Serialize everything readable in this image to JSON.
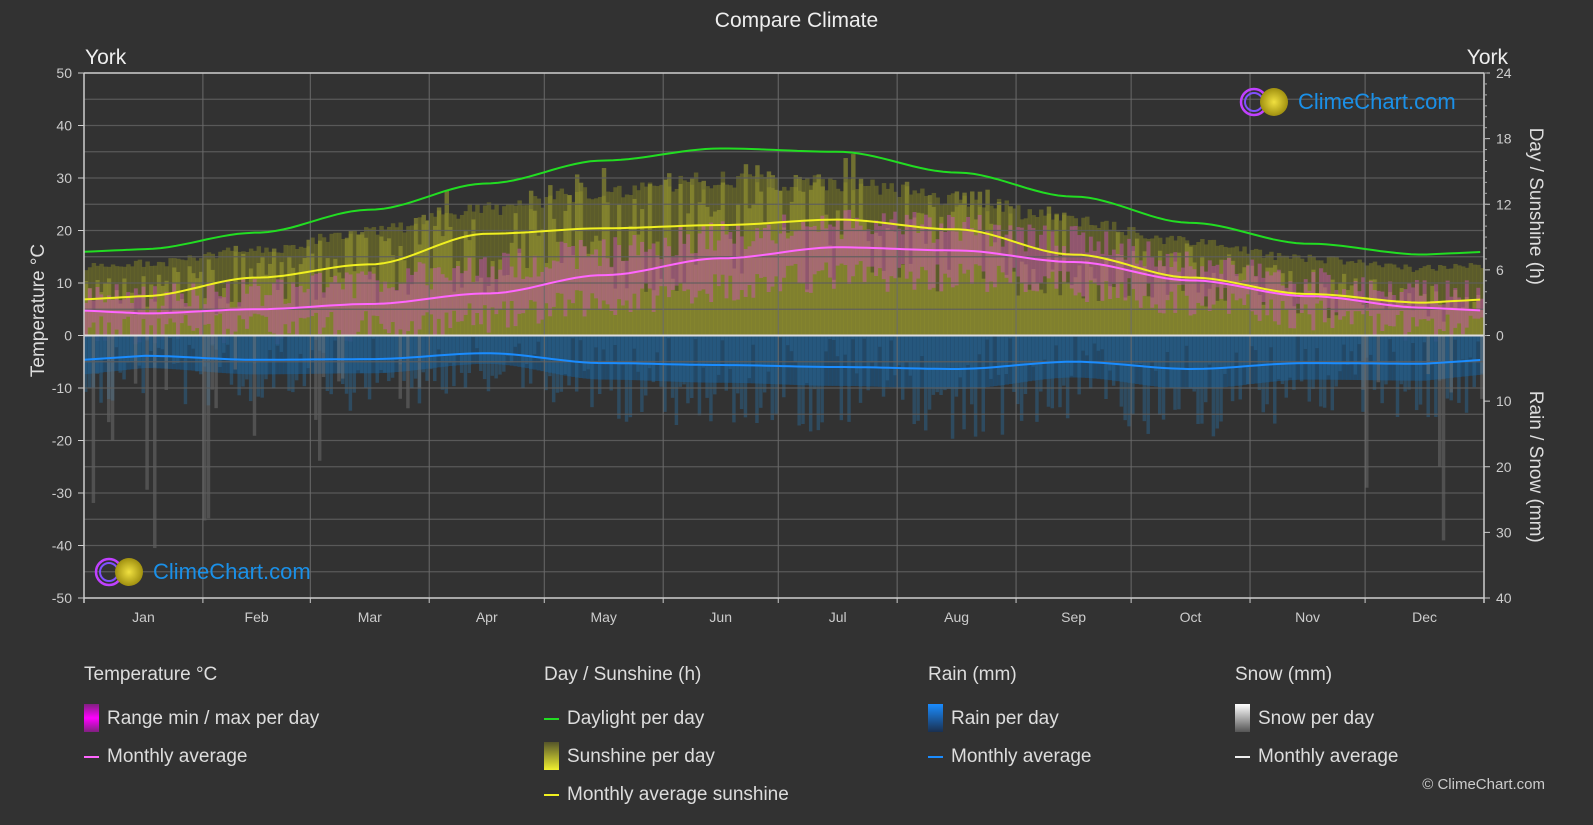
{
  "header": {
    "title": "Compare Climate",
    "city_left": "York",
    "city_right": "York"
  },
  "logo": {
    "text": "ClimeChart.com"
  },
  "copyright": "© ClimeChart.com",
  "legend": {
    "groups": [
      {
        "title": "Temperature °C",
        "items": [
          {
            "label": "Range min / max per day",
            "swatch": "box",
            "color": "#e600e6"
          },
          {
            "label": "Monthly average",
            "swatch": "line",
            "color": "#ff66ff"
          }
        ]
      },
      {
        "title": "Day / Sunshine (h)",
        "items": [
          {
            "label": "Daylight per day",
            "swatch": "line",
            "color": "#22dd22"
          },
          {
            "label": "Sunshine per day",
            "swatch": "box",
            "color": "#e6e633"
          },
          {
            "label": "Monthly average sunshine",
            "swatch": "line",
            "color": "#f0f020"
          }
        ]
      },
      {
        "title": "Rain (mm)",
        "items": [
          {
            "label": "Rain per day",
            "swatch": "box",
            "color": "#1a8cff"
          },
          {
            "label": "Monthly average",
            "swatch": "line",
            "color": "#1a8cff"
          }
        ]
      },
      {
        "title": "Snow (mm)",
        "items": [
          {
            "label": "Snow per day",
            "swatch": "box",
            "color": "#dddddd"
          },
          {
            "label": "Monthly average",
            "swatch": "line",
            "color": "#eeeeee"
          }
        ]
      }
    ]
  },
  "chart_data": {
    "type": "line",
    "title": "Compare Climate",
    "categories": [
      "Jan",
      "Feb",
      "Mar",
      "Apr",
      "May",
      "Jun",
      "Jul",
      "Aug",
      "Sep",
      "Oct",
      "Nov",
      "Dec"
    ],
    "left_axis": {
      "label": "Temperature °C",
      "range": [
        -50,
        50
      ],
      "ticks": [
        50,
        40,
        30,
        20,
        10,
        0,
        -10,
        -20,
        -30,
        -40,
        -50
      ]
    },
    "right_axis_top": {
      "label": "Day / Sunshine (h)",
      "range": [
        0,
        24
      ],
      "ticks": [
        24,
        18,
        12,
        6,
        0
      ]
    },
    "right_axis_bottom": {
      "label": "Rain / Snow (mm)",
      "range": [
        0,
        40
      ],
      "ticks": [
        0,
        10,
        20,
        30,
        40
      ]
    },
    "grid": true,
    "series": [
      {
        "name": "Temperature monthly average (°C)",
        "axis": "temp",
        "color": "#ff66ff",
        "values": [
          4.2,
          5.0,
          6.0,
          8.0,
          11.5,
          14.7,
          16.8,
          16.2,
          14.0,
          10.5,
          7.5,
          5.3
        ]
      },
      {
        "name": "Daylight per day (h)",
        "axis": "sun",
        "color": "#22dd22",
        "values": [
          7.9,
          9.4,
          11.5,
          13.9,
          16.0,
          17.1,
          16.8,
          14.9,
          12.7,
          10.3,
          8.4,
          7.4
        ]
      },
      {
        "name": "Monthly average sunshine (h)",
        "axis": "sun",
        "color": "#f0f020",
        "values": [
          3.6,
          5.3,
          6.5,
          9.3,
          9.8,
          10.1,
          10.6,
          9.7,
          7.4,
          5.3,
          3.8,
          3.0
        ]
      },
      {
        "name": "Rain monthly average (mm)",
        "axis": "rain",
        "color": "#1a8cff",
        "values": [
          3.1,
          3.7,
          3.6,
          2.7,
          4.2,
          4.5,
          4.8,
          5.1,
          4.0,
          5.1,
          4.2,
          4.3
        ]
      },
      {
        "name": "Snow monthly average (mm)",
        "axis": "rain",
        "color": "#eeeeee",
        "values": [
          0.2,
          0.2,
          0.1,
          0,
          0,
          0,
          0,
          0,
          0,
          0,
          0,
          0.1
        ]
      }
    ],
    "bands": {
      "temp_range_max_avg": [
        7,
        8,
        10,
        13,
        16,
        19,
        21,
        20.5,
        18,
        14,
        10,
        8
      ],
      "temp_range_min_avg": [
        1,
        1.5,
        2,
        3.5,
        6.5,
        9.5,
        11.5,
        11.5,
        9.5,
        7,
        4,
        2
      ]
    }
  }
}
